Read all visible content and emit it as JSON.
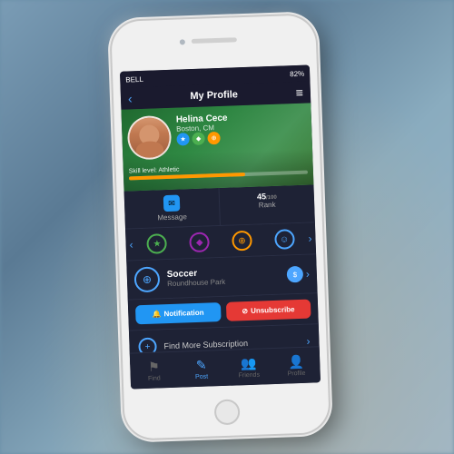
{
  "app": {
    "title": "My Profile"
  },
  "statusBar": {
    "carrier": "BELL",
    "signal": "●●●●",
    "wifi": "WiFi",
    "battery": "82%",
    "time": ""
  },
  "header": {
    "backLabel": "‹",
    "title": "My Profile",
    "menuIcon": "≡"
  },
  "profile": {
    "name": "Helina Cece",
    "location": "Boston, CM",
    "skillLabel": "Skill level: Athletic",
    "skillPercent": 65
  },
  "stats": {
    "message": {
      "label": "Message",
      "icon": "✉"
    },
    "rank": {
      "value": "45",
      "total": "/100",
      "label": "Rank"
    }
  },
  "achievements": {
    "items": [
      {
        "color": "#4CAF50",
        "icon": "★",
        "borderColor": "#4CAF50"
      },
      {
        "color": "#9C27B0",
        "icon": "◆",
        "borderColor": "#9C27B0"
      },
      {
        "color": "#FF9800",
        "icon": "⊕",
        "borderColor": "#FF9800"
      },
      {
        "color": "#4da6ff",
        "icon": "☺",
        "borderColor": "#4da6ff"
      }
    ]
  },
  "activity": {
    "name": "Soccer",
    "location": "Roundhouse Park",
    "icon": "⊕"
  },
  "buttons": {
    "notification": "Notification",
    "unsubscribe": "Unsubscribe"
  },
  "findMore": {
    "text": "Find More Subscription",
    "icon": "+"
  },
  "bottomNav": {
    "items": [
      {
        "label": "Find",
        "icon": "⚑",
        "active": false
      },
      {
        "label": "Post",
        "icon": "✎",
        "active": true
      },
      {
        "label": "Friends",
        "icon": "👥",
        "active": false
      },
      {
        "label": "Profile",
        "icon": "👤",
        "active": false
      }
    ]
  }
}
